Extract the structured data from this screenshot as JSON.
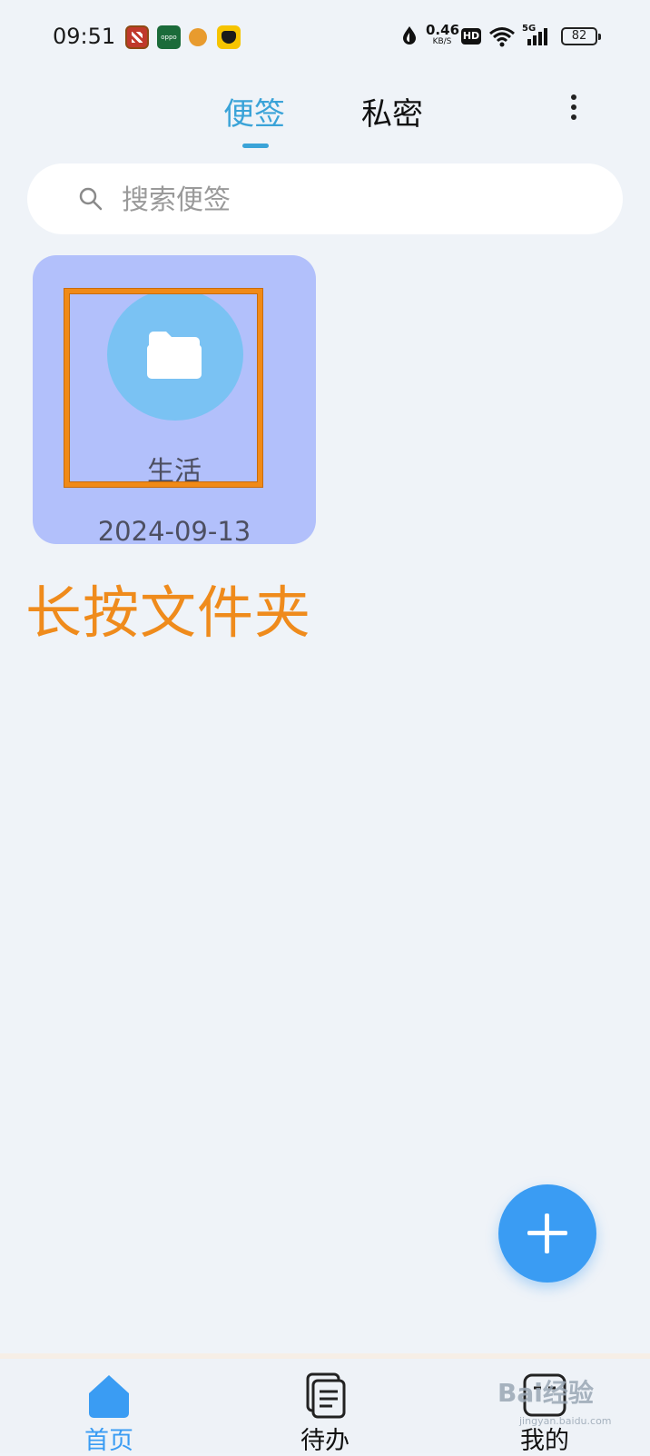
{
  "status_bar": {
    "time": "09:51",
    "notification_icons": [
      "chess-app-icon",
      "oppo-app-icon",
      "orange-app-icon",
      "game-app-icon"
    ],
    "oppo_label": "oppo",
    "net_speed_value": "0.46",
    "net_speed_unit": "KB/S",
    "hd_label": "HD",
    "network_label": "5G",
    "battery": "82"
  },
  "header": {
    "tabs": [
      {
        "label": "便签",
        "active": true
      },
      {
        "label": "私密",
        "active": false
      }
    ],
    "accent_color": "#3aa3d8"
  },
  "search": {
    "placeholder": "搜索便签"
  },
  "folder": {
    "name": "生活",
    "date": "2024-09-13",
    "icon": "folder-icon",
    "card_color": "#b2c0fb"
  },
  "annotation": {
    "instruction": "长按文件夹",
    "color": "#ef8b1c"
  },
  "fab": {
    "icon": "plus-icon",
    "color": "#3a9cf3"
  },
  "bottom_nav": {
    "items": [
      {
        "label": "首页",
        "icon": "home-icon",
        "active": true
      },
      {
        "label": "待办",
        "icon": "todo-icon",
        "active": false
      },
      {
        "label": "我的",
        "icon": "profile-icon",
        "active": false
      }
    ]
  },
  "watermark": {
    "text": "Bai经验",
    "url": "jingyan.baidu.com"
  }
}
